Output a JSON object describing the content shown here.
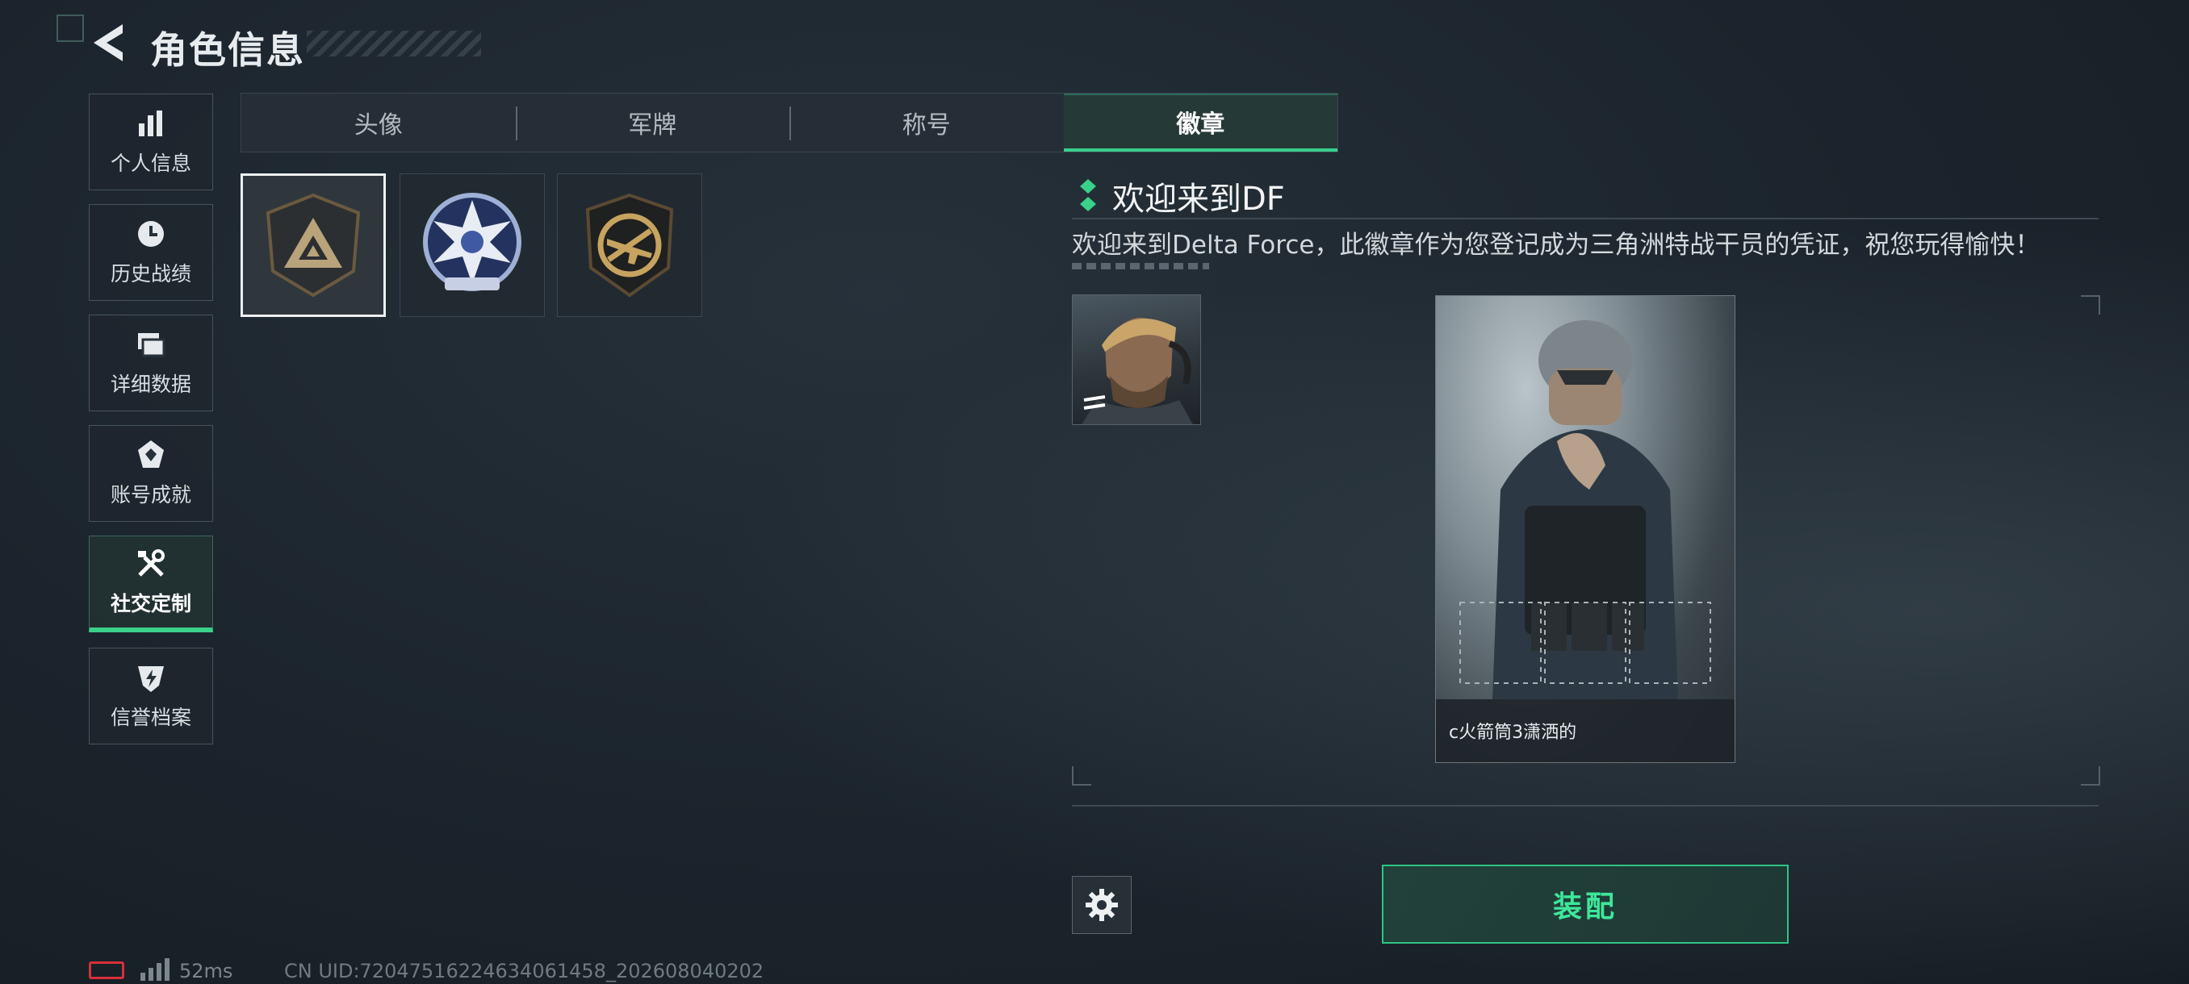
{
  "header": {
    "title": "角色信息"
  },
  "sidebar": {
    "items": [
      {
        "label": "个人信息",
        "icon": "bar-chart-icon",
        "active": false
      },
      {
        "label": "历史战绩",
        "icon": "clock-icon",
        "active": false
      },
      {
        "label": "详细数据",
        "icon": "folders-icon",
        "active": false
      },
      {
        "label": "账号成就",
        "icon": "medal-icon",
        "active": false
      },
      {
        "label": "社交定制",
        "icon": "tools-icon",
        "active": true
      },
      {
        "label": "信誉档案",
        "icon": "shield-bolt-icon",
        "active": false
      }
    ]
  },
  "tabs": [
    {
      "label": "头像",
      "active": false
    },
    {
      "label": "军牌",
      "active": false
    },
    {
      "label": "称号",
      "active": false
    },
    {
      "label": "徽章",
      "active": true
    }
  ],
  "badges": [
    {
      "icon": "delta-triangle-badge-icon",
      "selected": true
    },
    {
      "icon": "blue-star-badge-icon",
      "selected": false
    },
    {
      "icon": "rifle-prohibited-badge-icon",
      "selected": false
    }
  ],
  "detail": {
    "title": "欢迎来到DF",
    "description": "欢迎来到Delta Force，此徽章作为您登记成为三角洲特战干员的凭证，祝您玩得愉快！",
    "card_caption": "c火箭筒3潇洒的",
    "equip_label": "装配"
  },
  "status": {
    "ping": "52ms",
    "uid": "CN UID:720475162246340614​58_202608040202"
  },
  "colors": {
    "accent": "#3ad18a",
    "battery": "#d6303a"
  }
}
